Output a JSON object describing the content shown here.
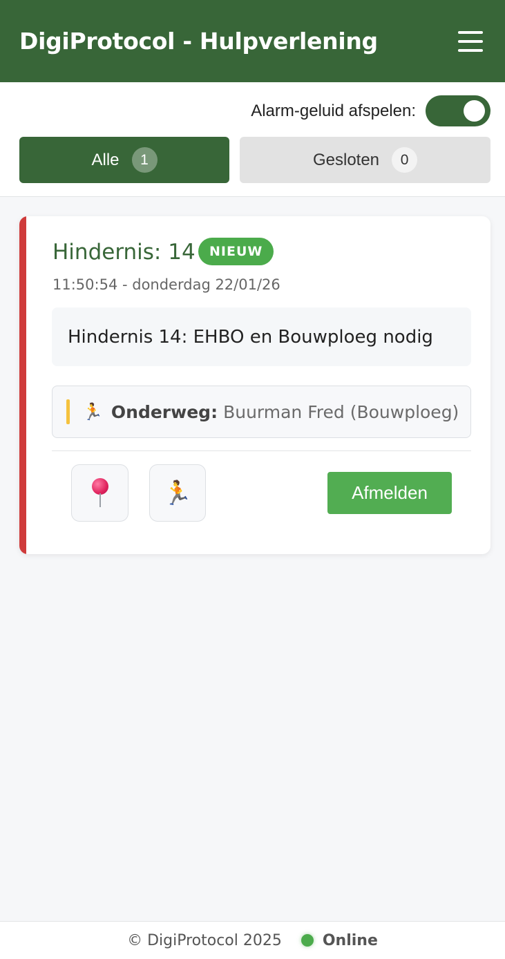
{
  "header": {
    "title": "DigiProtocol - Hulpverlening",
    "menu_icon": "hamburger-menu-icon"
  },
  "controls": {
    "alarm_label": "Alarm-geluid afspelen:",
    "alarm_enabled": true,
    "tabs": [
      {
        "label": "Alle",
        "count": "1",
        "active": true
      },
      {
        "label": "Gesloten",
        "count": "0",
        "active": false
      }
    ]
  },
  "card": {
    "title": "Hindernis: 14",
    "badge": "NIEUW",
    "time": "11:50:54 - donderdag 22/01/26",
    "message": "Hindernis 14: EHBO en Bouwploeg nodig",
    "status": {
      "icon": "🏃",
      "label": "Onderweg:",
      "value": "Buurman Fred (Bouwploeg)"
    },
    "actions": {
      "pin_icon": "map-pin-icon",
      "run_icon": "🏃",
      "primary_label": "Afmelden"
    },
    "colors": {
      "stripe": "#cf3b3b",
      "badge": "#4bab4b",
      "status_accent": "#f5c23e"
    }
  },
  "footer": {
    "copyright": "© DigiProtocol 2025",
    "status": "Online"
  },
  "colors": {
    "brand": "#386638",
    "primary_button": "#52ad52",
    "background": "#f6f7f9"
  }
}
